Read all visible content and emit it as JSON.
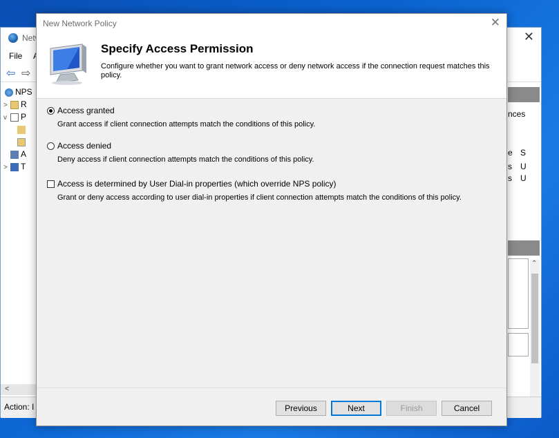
{
  "background_app": {
    "title": "Netw",
    "menu": {
      "file": "File",
      "action": "A"
    },
    "tree": [
      {
        "chevron": "",
        "label": "NPS"
      },
      {
        "chevron": ">",
        "label": "R"
      },
      {
        "chevron": "v",
        "label": "P"
      },
      {
        "chevron": "",
        "label": ""
      },
      {
        "chevron": "",
        "label": ""
      },
      {
        "chevron": "",
        "label": "A"
      },
      {
        "chevron": ">",
        "label": "T"
      }
    ],
    "status": "Action: I",
    "right_pane": {
      "ances": "nces",
      "col_e": "e",
      "col_s": "S",
      "rows": [
        {
          "a": "s",
          "b": "U"
        },
        {
          "a": "s",
          "b": "U"
        }
      ]
    }
  },
  "dialog": {
    "title": "New Network Policy",
    "header": {
      "title": "Specify Access Permission",
      "description": "Configure whether you want to grant network access or deny network access if the connection request matches this policy."
    },
    "options": [
      {
        "type": "radio",
        "checked": true,
        "label": "Access granted",
        "description": "Grant access if client connection attempts match the conditions of this policy."
      },
      {
        "type": "radio",
        "checked": false,
        "label": "Access denied",
        "description": "Deny access if client connection attempts match the conditions of this policy."
      },
      {
        "type": "checkbox",
        "checked": false,
        "label": "Access is determined by User Dial-in properties (which override NPS policy)",
        "description": "Grant or deny access according to user dial-in properties if client connection attempts match the conditions of this policy."
      }
    ],
    "buttons": {
      "previous": "Previous",
      "next": "Next",
      "finish": "Finish",
      "cancel": "Cancel"
    }
  },
  "colors": {
    "desktop": "#0a5fcc",
    "dialog_bg": "#f0f0f0",
    "accent": "#0078d7"
  },
  "icons": {
    "close": "close-icon",
    "monitor": "monitor-icon",
    "globe": "globe-icon"
  }
}
